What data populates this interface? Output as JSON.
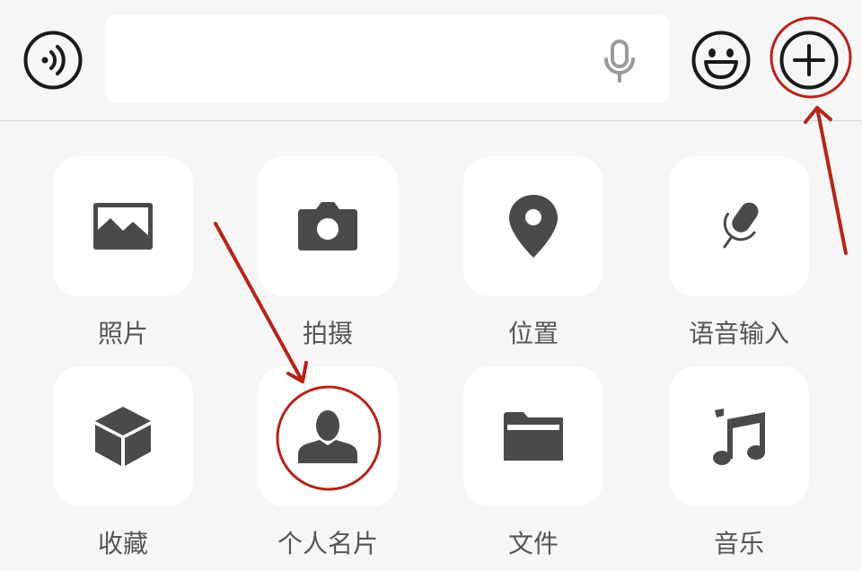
{
  "toolbar": {
    "voice_icon": "voice-wave-icon",
    "input_value": "",
    "input_mic_icon": "microphone-icon",
    "emoji_icon": "smiley-face-icon",
    "plus_icon": "plus-circle-icon"
  },
  "panel": {
    "items": [
      {
        "label": "照片",
        "icon": "photo-icon"
      },
      {
        "label": "拍摄",
        "icon": "camera-icon"
      },
      {
        "label": "位置",
        "icon": "location-pin-icon"
      },
      {
        "label": "语音输入",
        "icon": "voice-input-mic-icon"
      },
      {
        "label": "收藏",
        "icon": "favorites-cube-icon"
      },
      {
        "label": "个人名片",
        "icon": "contact-card-person-icon"
      },
      {
        "label": "文件",
        "icon": "folder-icon"
      },
      {
        "label": "音乐",
        "icon": "music-note-icon"
      }
    ]
  },
  "colors": {
    "background": "#f6f6f6",
    "tile": "#ffffff",
    "icon": "#4a4a4a",
    "label": "#555555",
    "annotation": "#b52418"
  }
}
